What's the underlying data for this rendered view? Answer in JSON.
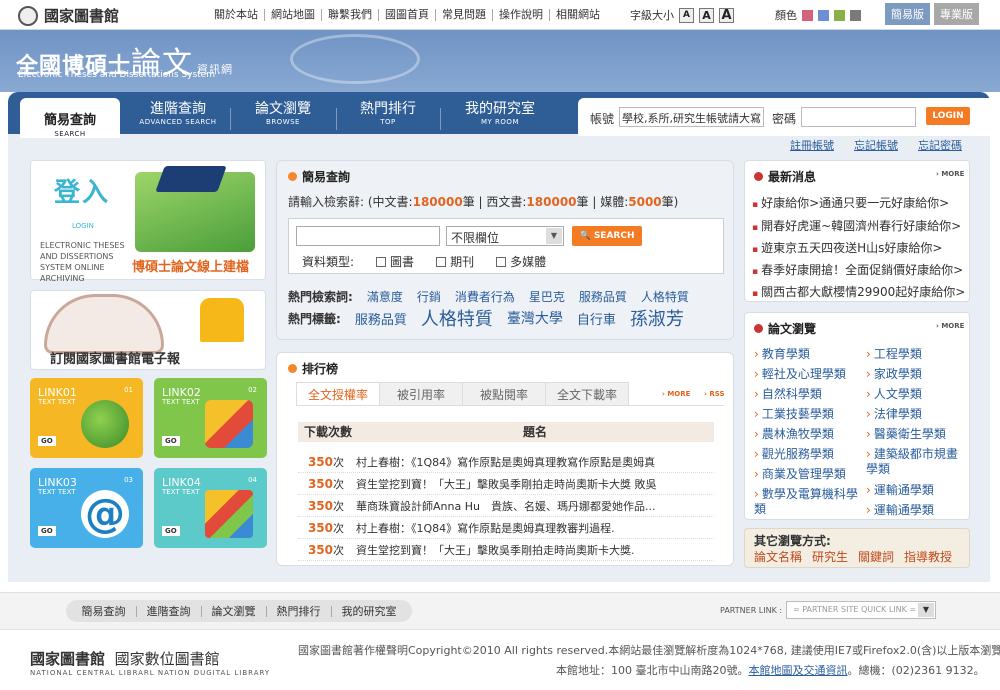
{
  "top": {
    "library": "國家圖書館",
    "links": [
      "關於本站",
      "網站地圖",
      "聯繫我們",
      "國圖首頁",
      "常見問題",
      "操作說明",
      "相關網站"
    ],
    "font_size_label": "字級大小",
    "font_sizes": [
      "A",
      "A",
      "A"
    ],
    "color_label": "顏色",
    "swatches": [
      "#d3627c",
      "#6f8fd4",
      "#8bb04a",
      "#7a7a7a"
    ],
    "version_simple": "簡易版",
    "version_pro": "專業版"
  },
  "banner": {
    "title_a": "全國",
    "title_b": "博碩士",
    "title_c": "論文",
    "title_d": "資訊網",
    "subtitle": "Electronic Theses and Dissertations System"
  },
  "nav": {
    "tabs": [
      {
        "label": "簡易查詢",
        "en": "SEARCH"
      },
      {
        "label": "進階查詢",
        "en": "ADVANCED SEARCH"
      },
      {
        "label": "論文瀏覽",
        "en": "BROWSE"
      },
      {
        "label": "熱門排行",
        "en": "TOP"
      },
      {
        "label": "我的研究室",
        "en": "MY ROOM"
      }
    ]
  },
  "login": {
    "account_label": "帳號",
    "account_value": "學校,系所,研究生帳號請大寫",
    "password_label": "密碼",
    "button": "LOGIN",
    "links": [
      "註冊帳號",
      "忘記帳號",
      "忘記密碼"
    ]
  },
  "promos": {
    "login_big": "登入",
    "login_en": "LOGIN",
    "en_text": "ELECTRONIC THESES AND DISSERTIONS SYSTEM ONLINE ARCHIVING",
    "online_caption": "博碩士論文線上建檔",
    "subscribe_caption": "訂閱國家圖書館電子報",
    "links": [
      {
        "name": "LINK01",
        "text": "TEXT TEXT",
        "num": "01",
        "go": "GO"
      },
      {
        "name": "LINK02",
        "text": "TEXT TEXT",
        "num": "02",
        "go": "GO"
      },
      {
        "name": "LINK03",
        "text": "TEXT TEXT",
        "num": "03",
        "go": "GO"
      },
      {
        "name": "LINK04",
        "text": "TEXT TEXT",
        "num": "04",
        "go": "GO"
      }
    ]
  },
  "quick_search": {
    "title": "簡易查詢",
    "stats_prefix": "請輸入檢索辭: (中文書:",
    "count_chinese": "180000",
    "stats_mid1": "筆 | 西文書:",
    "count_western": "180000",
    "stats_mid2": "筆 | 媒體:",
    "count_media": "5000",
    "stats_suffix": "筆)",
    "field_select": "不限欄位",
    "search_button": "SEARCH",
    "type_label": "資料類型:",
    "types": [
      "圖書",
      "期刊",
      "多媒體"
    ],
    "hot_keywords_label": "熱門檢索詞:",
    "hot_keywords": [
      "滿意度",
      "行銷",
      "消費者行為",
      "星巴克",
      "服務品質",
      "人格特質"
    ],
    "hot_tags_label": "熱門標籤:",
    "hot_tags": [
      {
        "text": "服務品質",
        "size": 13
      },
      {
        "text": "人格特質",
        "size": 18
      },
      {
        "text": "臺灣大學",
        "size": 14
      },
      {
        "text": "自行車",
        "size": 13
      },
      {
        "text": "孫淑芳",
        "size": 18
      }
    ]
  },
  "ranking": {
    "title": "排行榜",
    "tabs": [
      "全文授權率",
      "被引用率",
      "被點閱率",
      "全文下載率"
    ],
    "more": "MORE",
    "rss": "RSS",
    "col_count": "下載次數",
    "col_title": "題名",
    "rows": [
      {
        "count": "350",
        "unit": "次",
        "title": "村上春樹：《1Q84》寫作原點是奧姆真理教寫作原點是奧姆真"
      },
      {
        "count": "350",
        "unit": "次",
        "title": "資生堂挖到寶！「大王」擊敗吳季剛拍走時尚奧斯卡大獎 敗吳"
      },
      {
        "count": "350",
        "unit": "次",
        "title": "華商珠寶設計師Anna Hu　貴族、名媛、瑪丹娜都愛她作品..."
      },
      {
        "count": "350",
        "unit": "次",
        "title": "村上春樹：《1Q84》寫作原點是奧姆真理教審判過程."
      },
      {
        "count": "350",
        "unit": "次",
        "title": "資生堂挖到寶！「大王」擊敗吳季剛拍走時尚奧斯卡大獎."
      }
    ]
  },
  "news": {
    "title": "最新消息",
    "more": "MORE",
    "items": [
      "好康給你>通通只要一元好康給你>",
      "開春好虎運~韓國濟州春行好康給你>",
      "遊東京五天四夜送H山s好康給你>",
      "春季好康開搶！全面促銷價好康給你>",
      "關西古都大獻櫻情29900起好康給你>"
    ]
  },
  "browse": {
    "title": "論文瀏覽",
    "more": "MORE",
    "left": [
      "教育學類",
      "輕社及心理學類",
      "自然科學類",
      "工業技藝學類",
      "農林漁牧學類",
      "觀光服務學類",
      "商業及管理學類",
      "數學及電算機科學類"
    ],
    "right": [
      "工程學類",
      "家政學類",
      "人文學類",
      "法律學類",
      "醫藥衛生學類",
      "建築級都市規畫學類",
      "運輸通學類",
      "運輸通學類"
    ]
  },
  "other_browse": {
    "title": "其它瀏覽方式:",
    "links": [
      "論文名稱",
      "研究生",
      "關鍵詞",
      "指導教授"
    ]
  },
  "footer": {
    "nav": [
      "簡易查詢",
      "進階查詢",
      "論文瀏覽",
      "熱門排行",
      "我的研究室"
    ],
    "partner_label": "PARTNER LINK :",
    "partner_select": "= PARTNER SITE QUICK LINK =",
    "logo_a": "國家圖書館",
    "logo_b": "國家數位圖書館",
    "logo_en": "NATIONAL CENTRAL LIBRARL  NATION DUGITAL LIBRARY",
    "copyright": "國家圖書館著作權聲明Copyright©2010 All rights reserved.本網站最佳瀏覽解析度為1024*768, 建議使用IE7或Firefox2.0(含)以上版本瀏覽器",
    "address_a": "本館地址：100 臺北市中山南路20號。",
    "address_link": "本館地圖及交通資訊",
    "address_b": "。總機：(02)2361 9132。"
  }
}
